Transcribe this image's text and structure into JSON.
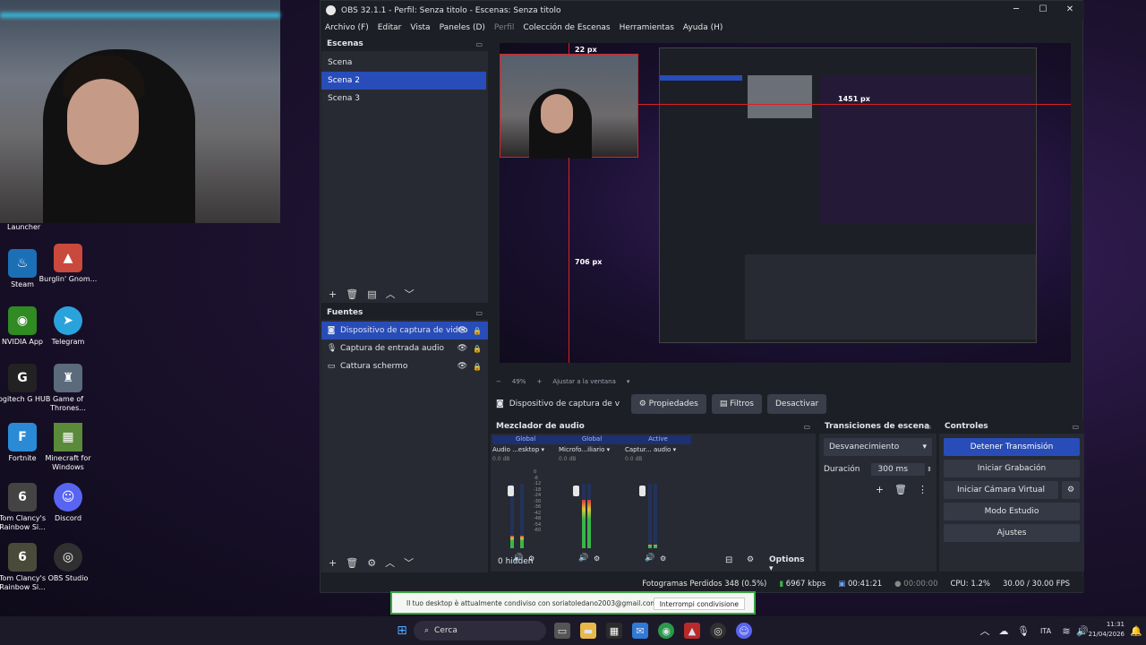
{
  "desktop": {
    "webcam_label": "Launcher",
    "icons": [
      {
        "label": "Steam",
        "icon": "steam-icon",
        "color": "#1b6fb5"
      },
      {
        "label": "Burglin' Gnom...",
        "icon": "gnome-icon",
        "color": "#c94a3c"
      },
      {
        "label": "NVIDIA App",
        "icon": "nvidia-icon",
        "color": "#2f8b22"
      },
      {
        "label": "Telegram",
        "icon": "telegram-icon",
        "color": "#2aa3dd"
      },
      {
        "label": "Logitech G HUB",
        "icon": "logitech-icon",
        "color": "#222222"
      },
      {
        "label": "Game of Thrones...",
        "icon": "got-icon",
        "color": "#5b6b7c"
      },
      {
        "label": "Fortnite",
        "icon": "fortnite-icon",
        "color": "#2a8ad6"
      },
      {
        "label": "Minecraft for Windows",
        "icon": "minecraft-icon",
        "color": "#5a8a3a"
      },
      {
        "label": "Tom Clancy's Rainbow Si...",
        "icon": "rainbow-six-icon",
        "color": "#444444"
      },
      {
        "label": "Discord",
        "icon": "discord-icon",
        "color": "#5865f2"
      },
      {
        "label": "Tom Clancy's Rainbow Si...",
        "icon": "rainbow-six-icon",
        "color": "#4a4a3a"
      },
      {
        "label": "OBS Studio",
        "icon": "obs-icon",
        "color": "#303030"
      }
    ]
  },
  "obs": {
    "title": "OBS 32.1.1 - Perfil: Senza titolo - Escenas: Senza titolo",
    "menu": [
      "Archivo (F)",
      "Editar",
      "Vista",
      "Paneles (D)",
      "Perfil",
      "Colección de Escenas",
      "Herramientas",
      "Ayuda (H)"
    ],
    "scenes_header": "Escenas",
    "scenes": [
      "Scena",
      "Scena 2",
      "Scena 3"
    ],
    "sources_header": "Fuentes",
    "sources": [
      "Dispositivo de captura de video",
      "Captura de entrada audio",
      "Cattura schermo"
    ],
    "preview_measures": {
      "top": "22 px",
      "right": "1451 px",
      "bottom": "706 px"
    },
    "preview_zoom": "49%",
    "preview_fit": "Ajustar a la ventana",
    "selected_source": "Dispositivo de captura de v",
    "properties": "Propiedades",
    "filters": "Filtros",
    "deactivate": "Desactivar",
    "mixer_header": "Mezclador de audio",
    "channels": [
      {
        "tag": "Global",
        "name": "Audio ...esktop",
        "db": "0.0 dB",
        "level": 0.2
      },
      {
        "tag": "Global",
        "name": "Microfo...iliario",
        "db": "0.0 dB",
        "level": 0.75
      },
      {
        "tag": "Active",
        "name": "Captur... audio",
        "db": "0.0 dB",
        "level": 0.05
      }
    ],
    "db_scale": [
      "0",
      "-6",
      "-12",
      "-18",
      "-24",
      "-30",
      "-36",
      "-42",
      "-48",
      "-54",
      "-60"
    ],
    "hidden": "0 hidden",
    "options": "Options",
    "transitions_header": "Transiciones de escena",
    "transition": "Desvanecimiento",
    "duration_label": "Duración",
    "duration": "300 ms",
    "controls_header": "Controles",
    "controls": [
      "Detener Transmisión",
      "Iniciar Grabación",
      "Iniciar Cámara Virtual",
      "Modo Estudio",
      "Ajustes"
    ],
    "status": {
      "dropped": "Fotogramas Perdidos 348 (0.5%)",
      "kbps": "6967 kbps",
      "live": "00:41:21",
      "rec": "00:00:00",
      "cpu": "CPU: 1.2%",
      "fps": "30.00 / 30.00 FPS"
    }
  },
  "share": {
    "text": "Il tuo desktop è attualmente condiviso con soriatoledano2003@gmail.com",
    "button": "Interrompi condivisione"
  },
  "taskbar": {
    "search": "Cerca",
    "lang": "ITA",
    "time": "11:31",
    "date": "21/04/2026"
  },
  "accent": "#284cb8"
}
